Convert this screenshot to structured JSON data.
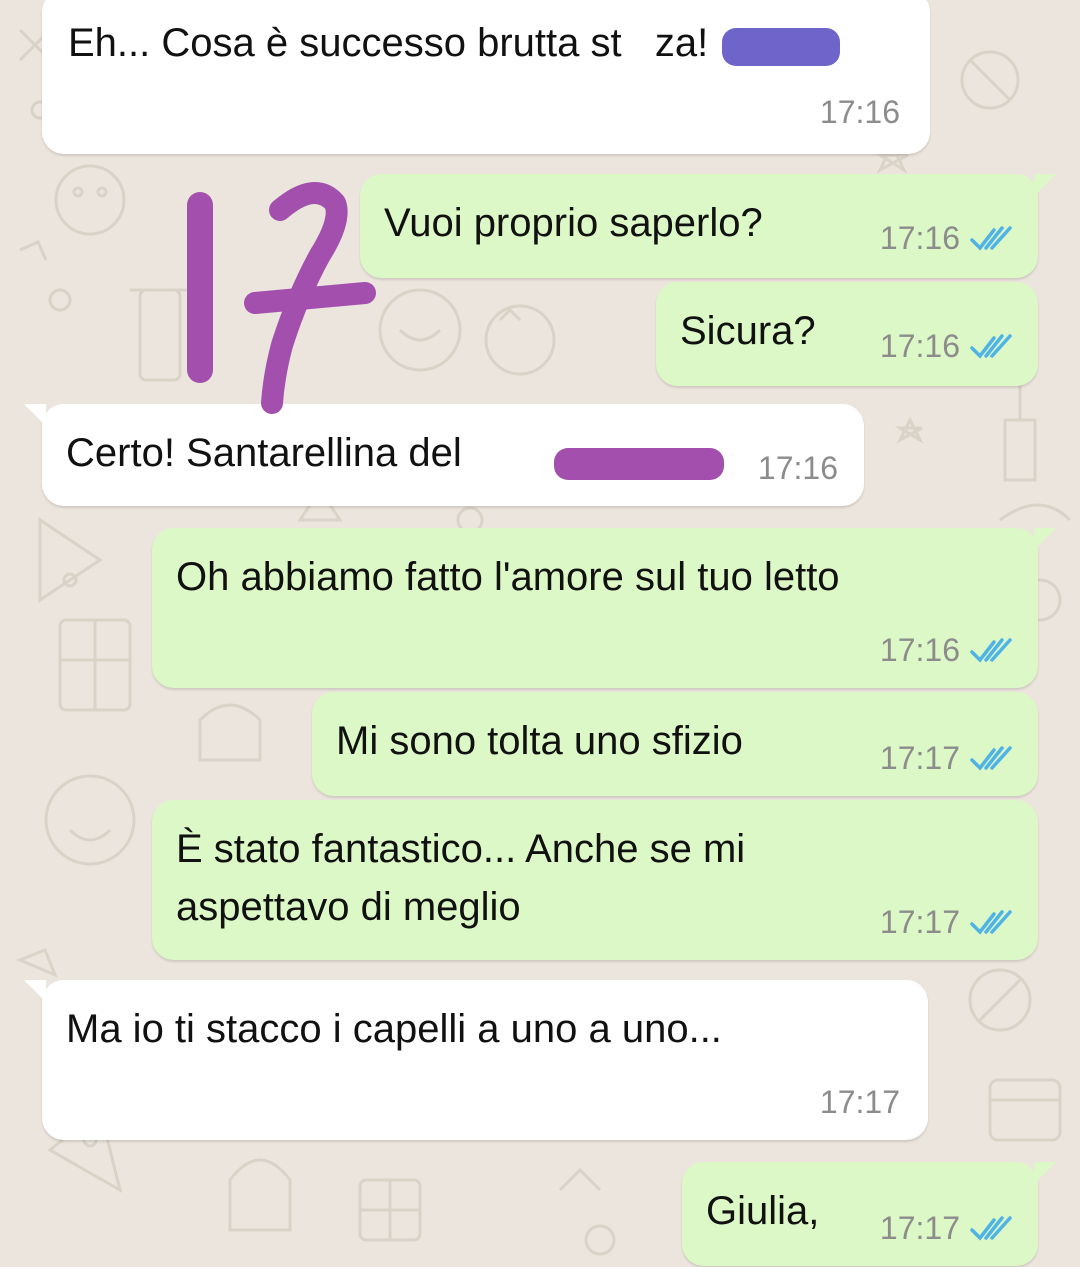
{
  "colors": {
    "incoming_bubble": "#ffffff",
    "outgoing_bubble": "#dcf8c6",
    "timestamp": "#8c8c8c",
    "read_ticks": "#4fb3e6",
    "redaction_blue": "#6e64c9",
    "redaction_purple": "#a24fae",
    "scribble_purple": "#a24fae",
    "wallpaper": "#ece5dd"
  },
  "overlay": {
    "handwritten_number": "17"
  },
  "messages": [
    {
      "direction": "in",
      "text": "Eh... Cosa è successo brutta st   za!",
      "time": "17:16"
    },
    {
      "direction": "out",
      "text": "Vuoi proprio saperlo?",
      "time": "17:16",
      "status": "read"
    },
    {
      "direction": "out",
      "text": "Sicura?",
      "time": "17:16",
      "status": "read"
    },
    {
      "direction": "in",
      "text": "Certo! Santarellina del",
      "time": "17:16"
    },
    {
      "direction": "out",
      "text": "Oh abbiamo fatto l'amore sul tuo letto",
      "time": "17:16",
      "status": "read"
    },
    {
      "direction": "out",
      "text": "Mi sono tolta uno sfizio",
      "time": "17:17",
      "status": "read"
    },
    {
      "direction": "out",
      "text": "È stato fantastico... Anche se mi\naspettavo di meglio",
      "time": "17:17",
      "status": "read"
    },
    {
      "direction": "in",
      "text": "Ma io ti stacco i capelli a uno a uno...",
      "time": "17:17"
    },
    {
      "direction": "out",
      "text": "Giulia,",
      "time": "17:17",
      "status": "read"
    }
  ]
}
